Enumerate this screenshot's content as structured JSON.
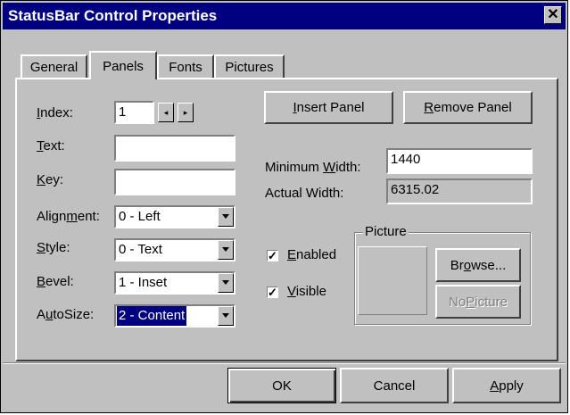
{
  "window": {
    "title": "StatusBar Control Properties",
    "close_glyph": "✕"
  },
  "tabs": [
    {
      "label": "General",
      "active": false
    },
    {
      "label": "Panels",
      "active": true
    },
    {
      "label": "Fonts",
      "active": false
    },
    {
      "label": "Pictures",
      "active": false
    }
  ],
  "panels": {
    "index": {
      "label_pre": "",
      "label_key": "I",
      "label_post": "ndex:",
      "value": "1",
      "prev_glyph": "◂",
      "next_glyph": "▸"
    },
    "text": {
      "label_pre": "",
      "label_key": "T",
      "label_post": "ext:",
      "value": ""
    },
    "key": {
      "label_pre": "",
      "label_key": "K",
      "label_post": "ey:",
      "value": ""
    },
    "alignment": {
      "label_pre": "Align",
      "label_key": "m",
      "label_post": "ent:",
      "value": "0 - Left"
    },
    "style": {
      "label_pre": "",
      "label_key": "S",
      "label_post": "tyle:",
      "value": "0 - Text"
    },
    "bevel": {
      "label_pre": "",
      "label_key": "B",
      "label_post": "evel:",
      "value": "1 - Inset"
    },
    "autosize": {
      "label_pre": "A",
      "label_key": "u",
      "label_post": "toSize:",
      "value": "2 - Content"
    },
    "insert_panel": {
      "pre": "",
      "key": "I",
      "post": "nsert Panel"
    },
    "remove_panel": {
      "pre": "",
      "key": "R",
      "post": "emove Panel"
    },
    "minimum_width": {
      "label_pre": "Minimum ",
      "label_key": "W",
      "label_post": "idth:",
      "value": "1440"
    },
    "actual_width": {
      "label": "Actual Width:",
      "value": "6315.02"
    },
    "enabled": {
      "label_pre": "",
      "label_key": "E",
      "label_post": "nabled",
      "checked": true
    },
    "visible": {
      "label_pre": "",
      "label_key": "V",
      "label_post": "isible",
      "checked": true
    },
    "check_glyph": "✓",
    "picture": {
      "group_title": "Picture",
      "browse": {
        "pre": "Br",
        "key": "o",
        "post": "wse..."
      },
      "no_picture": {
        "pre": "No ",
        "key": "P",
        "post": "icture",
        "enabled": false
      }
    }
  },
  "footer": {
    "ok": "OK",
    "cancel": "Cancel",
    "apply": {
      "pre": "",
      "key": "A",
      "post": "pply"
    }
  },
  "colors": {
    "face": "#c0c0c0",
    "title_bar": "#000080",
    "selection": "#000080"
  }
}
